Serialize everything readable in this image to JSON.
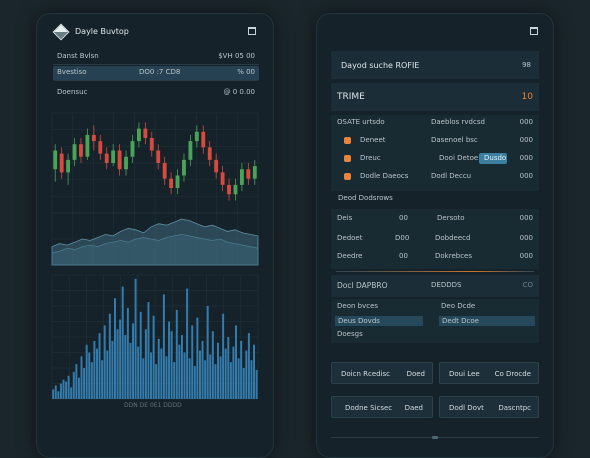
{
  "left_panel": {
    "title": "Dayle Buvtop",
    "rows": [
      {
        "label": "Danst Bvlsn",
        "value": "$VH 05 00"
      },
      {
        "label": "Bvestiso",
        "mid": "DO0 :7 CD8",
        "value": "%  00"
      },
      {
        "label": "Doensuc",
        "value": "@  0 0.00"
      }
    ],
    "axis_label": "DDN  DE  0E1  DDDD"
  },
  "right_panel": {
    "title": "Dayod suche ROFIE",
    "title_value": "98",
    "section_title": "TRIME",
    "section_value": "10",
    "options": [
      {
        "label": "OSATE urtsdo",
        "col2": "Daeblos rvdcsd",
        "value": "000"
      },
      {
        "label": "Deneet",
        "col2": "Dasenoel  bsc",
        "value": "000"
      },
      {
        "label": "Dreuc",
        "col2": "Dooi Detoe",
        "pill": "Dusdo",
        "value": "000"
      },
      {
        "label": "Dodle Daeocs",
        "col2": "Dodl Deccu",
        "value": "000"
      }
    ],
    "subheading": "Deod Dodsrows",
    "fields": [
      {
        "label": "Deis",
        "mid": "00",
        "label2": "Dersoto",
        "value": "000"
      },
      {
        "label": "Dedoet",
        "mid": "D00",
        "label2": "Dobdeecd",
        "value": "000"
      },
      {
        "label": "Deedre",
        "mid": "00",
        "label2": "Dokrebces",
        "value": "000"
      }
    ],
    "sub2_label": "Docl DAPBRO",
    "sub2_mid": "DEDDDS",
    "sub2_value": "CO",
    "inputs": [
      {
        "label": "Deon bvces",
        "label2": "Deo Dcde"
      },
      {
        "label": "Deus Dovds",
        "label2": "Dedt Dcoe"
      },
      {
        "label": "Doesgs",
        "label2": ""
      }
    ],
    "buttons": [
      {
        "a": "Doicn Rcedisc",
        "b": "Doed"
      },
      {
        "a": "Doui Lee",
        "b": "Co Drocde"
      },
      {
        "a": "Dodne  Sicsec",
        "b": "Daed"
      },
      {
        "a": "Dodl Dovt",
        "b": "Dascntpc"
      }
    ]
  },
  "colors": {
    "background": "#1b262c",
    "panel": "#15222a",
    "accent_orange": "#e8843b",
    "candle_up": "#4aa356",
    "candle_down": "#d84a3e",
    "bar_blue": "#3a8cc4"
  },
  "chart_data": [
    {
      "type": "candlestick",
      "title": "",
      "candles": [
        [
          52,
          58,
          48,
          60
        ],
        [
          57,
          51,
          49,
          59
        ],
        [
          51,
          55,
          47,
          57
        ],
        [
          55,
          60,
          53,
          62
        ],
        [
          60,
          56,
          54,
          62
        ],
        [
          56,
          63,
          55,
          65
        ],
        [
          63,
          61,
          58,
          66
        ],
        [
          61,
          57,
          55,
          63
        ],
        [
          57,
          54,
          52,
          59
        ],
        [
          54,
          58,
          53,
          60
        ],
        [
          58,
          52,
          50,
          60
        ],
        [
          52,
          56,
          50,
          58
        ],
        [
          56,
          61,
          54,
          63
        ],
        [
          61,
          65,
          59,
          67
        ],
        [
          65,
          62,
          60,
          67
        ],
        [
          62,
          58,
          56,
          64
        ],
        [
          58,
          54,
          52,
          60
        ],
        [
          54,
          49,
          47,
          56
        ],
        [
          49,
          46,
          44,
          51
        ],
        [
          46,
          50,
          44,
          52
        ],
        [
          50,
          55,
          48,
          57
        ],
        [
          55,
          61,
          53,
          63
        ],
        [
          61,
          64,
          59,
          66
        ],
        [
          64,
          59,
          57,
          66
        ],
        [
          59,
          55,
          53,
          61
        ],
        [
          55,
          51,
          49,
          57
        ],
        [
          51,
          47,
          45,
          53
        ],
        [
          47,
          44,
          42,
          49
        ],
        [
          44,
          47,
          42,
          49
        ],
        [
          47,
          52,
          45,
          54
        ],
        [
          52,
          49,
          47,
          54
        ],
        [
          49,
          53,
          47,
          55
        ]
      ]
    },
    {
      "type": "area",
      "series": [
        {
          "values": [
            12,
            14,
            13,
            15,
            17,
            16,
            18,
            20,
            19,
            22,
            24,
            23,
            21,
            25,
            27,
            26,
            28,
            30,
            29,
            27,
            25,
            26,
            24,
            22,
            23,
            21,
            20,
            19
          ]
        },
        {
          "values": [
            8,
            9,
            11,
            10,
            12,
            13,
            12,
            14,
            15,
            16,
            15,
            17,
            18,
            17,
            16,
            18,
            19,
            20,
            19,
            18,
            17,
            16,
            17,
            15,
            14,
            13,
            12,
            11
          ]
        }
      ]
    },
    {
      "type": "bar",
      "values": [
        5,
        7,
        4,
        8,
        10,
        9,
        12,
        6,
        14,
        18,
        11,
        22,
        16,
        28,
        24,
        19,
        30,
        26,
        34,
        20,
        38,
        25,
        44,
        30,
        52,
        36,
        41,
        58,
        33,
        47,
        29,
        39,
        62,
        27,
        45,
        21,
        36,
        50,
        24,
        43,
        18,
        31,
        26,
        54,
        22,
        40,
        35,
        19,
        46,
        28,
        33,
        24,
        57,
        21,
        38,
        17,
        42,
        25,
        30,
        20,
        48,
        23,
        35,
        18,
        29,
        22,
        44,
        26,
        32,
        19,
        27,
        38,
        21,
        30,
        16,
        25,
        34,
        20,
        28,
        15
      ]
    }
  ]
}
